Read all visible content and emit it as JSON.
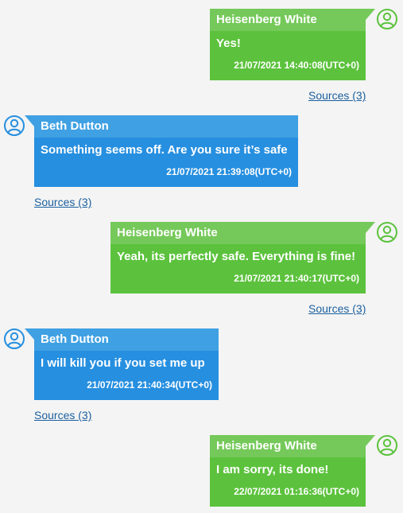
{
  "colors": {
    "outgoing_header": "#75c95a",
    "outgoing_body": "#5cc23d",
    "incoming_header": "#3fa0e3",
    "incoming_body": "#268fe0",
    "link": "#1b5f9e",
    "background": "#f4f4f4"
  },
  "messages": [
    {
      "direction": "outgoing",
      "sender": "Heisenberg White",
      "text": "Yes!",
      "timestamp": "21/07/2021 14:40:08(UTC+0)",
      "sources_label": "Sources (3)",
      "avatar_icon": "user-avatar-icon"
    },
    {
      "direction": "incoming",
      "sender": "Beth Dutton",
      "text": "Something seems off. Are you sure it’s safe",
      "timestamp": "21/07/2021 21:39:08(UTC+0)",
      "sources_label": "Sources (3)",
      "avatar_icon": "user-avatar-icon"
    },
    {
      "direction": "outgoing",
      "sender": "Heisenberg White",
      "text": "Yeah, its perfectly safe. Everything is fine!",
      "timestamp": "21/07/2021 21:40:17(UTC+0)",
      "sources_label": "Sources (3)",
      "avatar_icon": "user-avatar-icon"
    },
    {
      "direction": "incoming",
      "sender": "Beth Dutton",
      "text": "I will kill you if you set me up",
      "timestamp": "21/07/2021 21:40:34(UTC+0)",
      "sources_label": "Sources (3)",
      "avatar_icon": "user-avatar-icon"
    },
    {
      "direction": "outgoing",
      "sender": "Heisenberg White",
      "text": "I am sorry, its done!",
      "timestamp": "22/07/2021 01:16:36(UTC+0)",
      "sources_label": "",
      "avatar_icon": "user-avatar-icon"
    }
  ]
}
